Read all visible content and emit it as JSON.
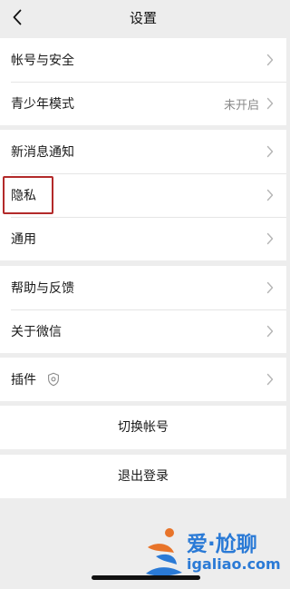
{
  "header": {
    "title": "设置"
  },
  "group1": [
    {
      "label": "帐号与安全",
      "value": ""
    },
    {
      "label": "青少年模式",
      "value": "未开启"
    }
  ],
  "group2": [
    {
      "label": "新消息通知"
    },
    {
      "label": "隐私"
    },
    {
      "label": "通用"
    }
  ],
  "group3": [
    {
      "label": "帮助与反馈"
    },
    {
      "label": "关于微信"
    }
  ],
  "group4": [
    {
      "label": "插件"
    }
  ],
  "switch_account": "切换帐号",
  "logout": "退出登录",
  "watermark": {
    "title": "爱·尬聊",
    "subtitle": "igaliao.com"
  },
  "colors": {
    "background": "#ededed",
    "card": "#ffffff",
    "highlight": "#b32a2a",
    "watermark": "#2a7ad6"
  },
  "icons": {
    "back": "chevron-left-icon",
    "chevron": "chevron-right-icon",
    "plugin": "shield-icon"
  }
}
